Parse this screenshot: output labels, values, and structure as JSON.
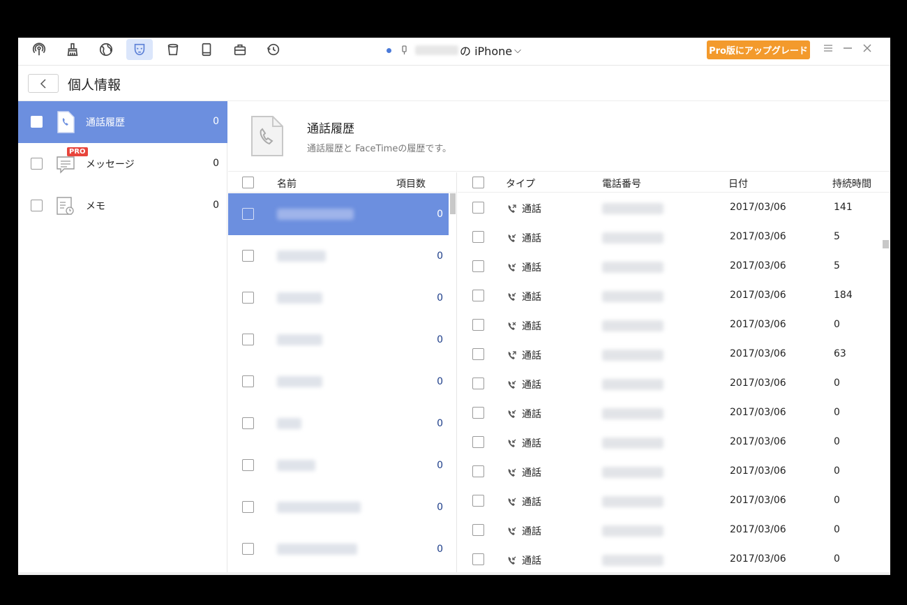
{
  "titlebar": {
    "device_name": "の iPhone",
    "device_chevron": "⌵",
    "upgrade_label": "Pro版にアップグレード",
    "icons": [
      "podcast-icon",
      "broom-icon",
      "globe-icon",
      "privacy-mask-icon",
      "bucket-icon",
      "book-icon",
      "toolbox-icon",
      "history-icon"
    ]
  },
  "header": {
    "title": "個人情報"
  },
  "sidebar": {
    "items": [
      {
        "label": "通話履歴",
        "count": "0"
      },
      {
        "label": "メッセージ",
        "count": "0",
        "badge": "PRO"
      },
      {
        "label": "メモ",
        "count": "0"
      }
    ]
  },
  "info": {
    "title": "通話履歴",
    "description": "通話履歴と FaceTimeの履歴です。"
  },
  "contacts": {
    "header_name": "名前",
    "header_count": "項目数",
    "rows": [
      {
        "count": "0"
      },
      {
        "count": "0"
      },
      {
        "count": "0"
      },
      {
        "count": "0"
      },
      {
        "count": "0"
      },
      {
        "count": "0"
      },
      {
        "count": "0"
      },
      {
        "count": "0"
      },
      {
        "count": "0"
      }
    ]
  },
  "calls": {
    "headers": {
      "type": "タイプ",
      "phone": "電話番号",
      "date": "日付",
      "duration": "持続時間"
    },
    "rows": [
      {
        "direction": "outgoing",
        "type": "通話",
        "date": "2017/03/06",
        "duration": "141"
      },
      {
        "direction": "incoming",
        "type": "通話",
        "date": "2017/03/06",
        "duration": "5"
      },
      {
        "direction": "incoming",
        "type": "通話",
        "date": "2017/03/06",
        "duration": "5"
      },
      {
        "direction": "incoming",
        "type": "通話",
        "date": "2017/03/06",
        "duration": "184"
      },
      {
        "direction": "missed",
        "type": "通話",
        "date": "2017/03/06",
        "duration": "0"
      },
      {
        "direction": "outgoing",
        "type": "通話",
        "date": "2017/03/06",
        "duration": "63"
      },
      {
        "direction": "incoming",
        "type": "通話",
        "date": "2017/03/06",
        "duration": "0"
      },
      {
        "direction": "incoming",
        "type": "通話",
        "date": "2017/03/06",
        "duration": "0"
      },
      {
        "direction": "incoming",
        "type": "通話",
        "date": "2017/03/06",
        "duration": "0"
      },
      {
        "direction": "incoming",
        "type": "通話",
        "date": "2017/03/06",
        "duration": "0"
      },
      {
        "direction": "incoming",
        "type": "通話",
        "date": "2017/03/06",
        "duration": "0"
      },
      {
        "direction": "incoming",
        "type": "通話",
        "date": "2017/03/06",
        "duration": "0"
      },
      {
        "direction": "incoming",
        "type": "通話",
        "date": "2017/03/06",
        "duration": "0"
      }
    ]
  },
  "colors": {
    "accent": "#6c8fdf",
    "upgrade": "#f39a2c",
    "count_text": "#1f3f8a"
  }
}
